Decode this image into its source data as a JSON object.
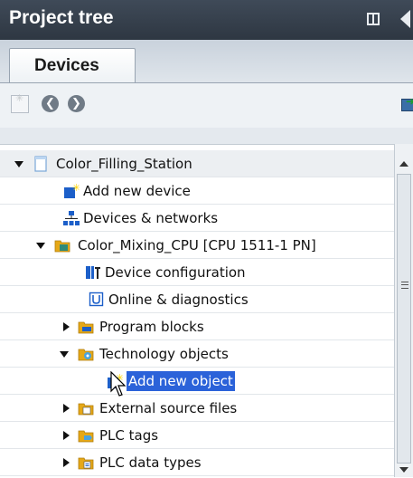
{
  "panel": {
    "title": "Project tree",
    "layout_icon": "panel-layout-icon",
    "collapse_icon": "collapse-left-icon"
  },
  "tabs": [
    {
      "label": "Devices",
      "active": true
    }
  ],
  "toolbar": {
    "new_group_icon": "new-group-icon",
    "back_icon": "back-arrow-icon",
    "forward_icon": "forward-arrow-icon",
    "overview_icon": "overview-icon",
    "back_glyph": "❮",
    "forward_glyph": "❯"
  },
  "tree": [
    {
      "label": "Color_Filling_Station",
      "icon": "project-icon",
      "expander": "open"
    },
    {
      "label": "Add new device",
      "icon": "add-device-icon",
      "expander": "none"
    },
    {
      "label": "Devices & networks",
      "icon": "network-icon",
      "expander": "none"
    },
    {
      "label": "Color_Mixing_CPU [CPU 1511-1 PN]",
      "icon": "cpu-icon",
      "expander": "open"
    },
    {
      "label": "Device configuration",
      "icon": "device-config-icon",
      "expander": "none"
    },
    {
      "label": "Online & diagnostics",
      "icon": "diagnostics-icon",
      "expander": "none"
    },
    {
      "label": "Program blocks",
      "icon": "folder-icon",
      "expander": "closed"
    },
    {
      "label": "Technology objects",
      "icon": "technology-folder-icon",
      "expander": "open"
    },
    {
      "label": "Add new object",
      "icon": "add-object-icon",
      "expander": "none",
      "selected": true
    },
    {
      "label": "External source files",
      "icon": "folder-icon",
      "expander": "closed"
    },
    {
      "label": "PLC tags",
      "icon": "folder-icon",
      "expander": "closed"
    },
    {
      "label": "PLC data types",
      "icon": "folder-icon",
      "expander": "closed"
    }
  ],
  "colors": {
    "title_bar": "#2e3742",
    "selection": "#2b62d9",
    "folder": "#e6a817",
    "accent_blue": "#1c5fc9"
  }
}
